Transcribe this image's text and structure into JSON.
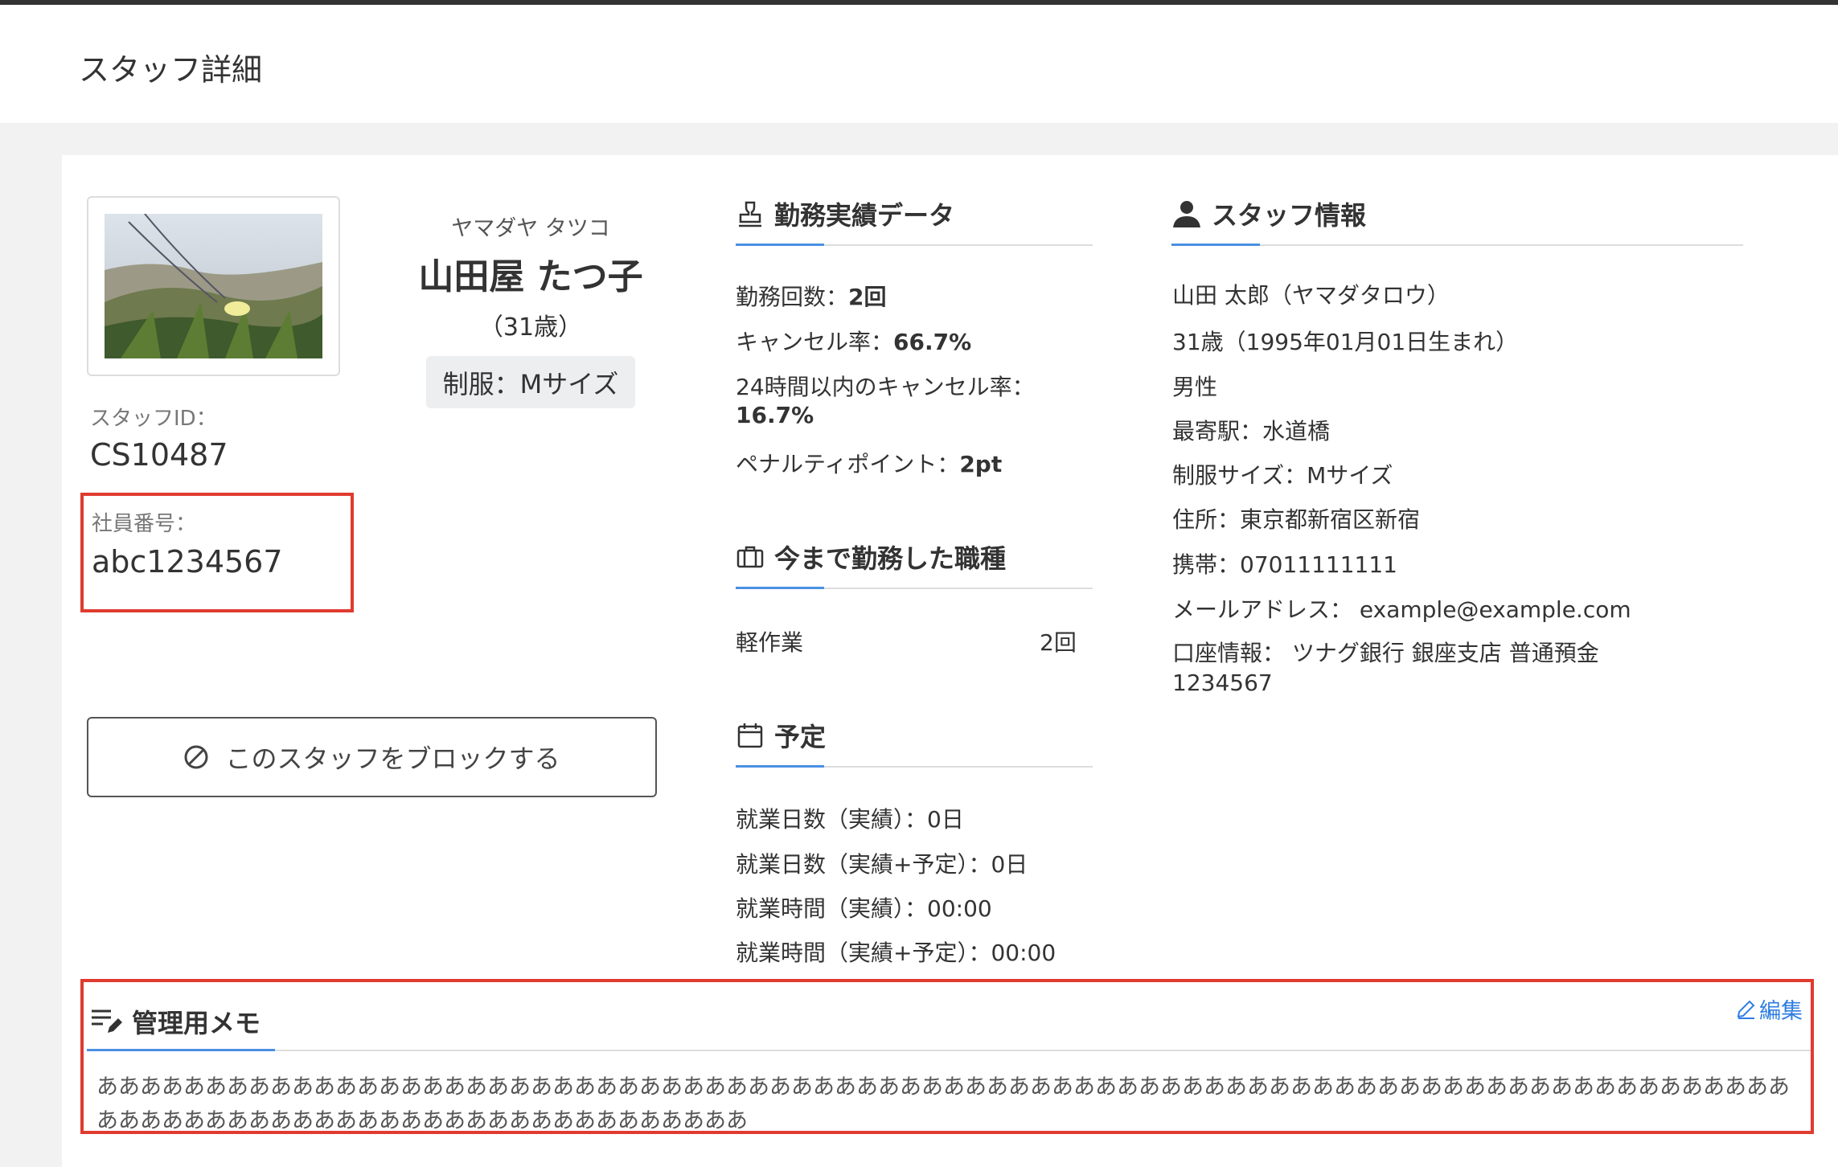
{
  "header": {
    "title": "スタッフ詳細"
  },
  "profile": {
    "kana": "ヤマダヤ タツコ",
    "name": "山田屋 たつ子",
    "age": "（31歳）",
    "uniform": "制服：Mサイズ",
    "staff_id_label": "スタッフID：",
    "staff_id": "CS10487",
    "employee_no_label": "社員番号：",
    "employee_no": "abc1234567",
    "block_button": "このスタッフをブロックする"
  },
  "work_record": {
    "title": "勤務実績データ",
    "count_label": "勤務回数：",
    "count": "2回",
    "cancel_label": "キャンセル率：",
    "cancel": "66.7%",
    "cancel24_label": "24時間以内のキャンセル率：",
    "cancel24": "16.7%",
    "penalty_label": "ペナルティポイント：",
    "penalty": "2pt"
  },
  "job_types": {
    "title": "今まで勤務した職種",
    "items": [
      {
        "name": "軽作業",
        "count": "2回"
      }
    ]
  },
  "schedule": {
    "title": "予定",
    "lines": [
      "就業日数（実績）：0日",
      "就業日数（実績+予定）：0日",
      "就業時間（実績）：00:00",
      "就業時間（実績+予定）：00:00"
    ]
  },
  "staff_info": {
    "title": "スタッフ情報",
    "lines": [
      "山田 太郎（ヤマダタロウ）",
      "31歳（1995年01月01日生まれ）",
      "男性",
      "最寄駅：水道橋",
      "制服サイズ：Mサイズ",
      "住所：東京都新宿区新宿",
      "携帯：07011111111",
      "メールアドレス： example@example.com"
    ],
    "bank": "口座情報： ツナグ銀行 銀座支店 普通預金",
    "bank_account": "1234567"
  },
  "memo": {
    "title": "管理用メモ",
    "edit": "編集",
    "text": "ああああああああああああああああああああああああああああああああああああああああああああああああああああああああああああああああああああああああああああああああああああああああああああああああああああああああああああ"
  }
}
